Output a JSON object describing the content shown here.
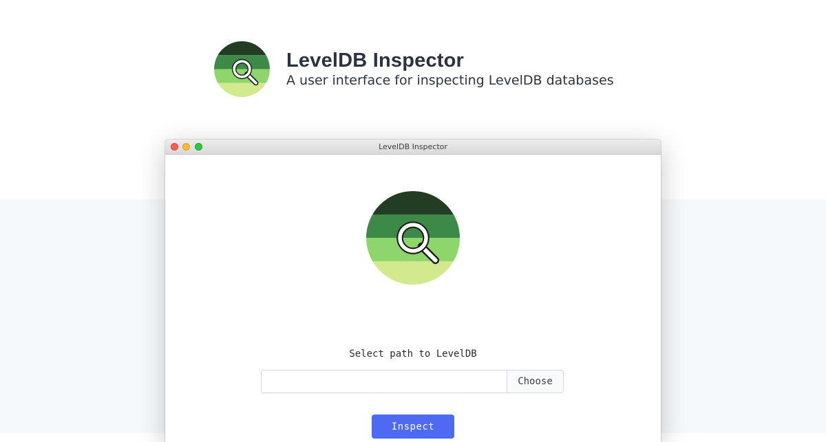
{
  "hero": {
    "title": "LevelDB Inspector",
    "subtitle": "A user interface for inspecting LevelDB databases",
    "logo_icon": "magnifier-stripes-logo-icon"
  },
  "window": {
    "title": "LevelDB Inspector",
    "traffic_lights": [
      "close",
      "minimize",
      "maximize"
    ]
  },
  "form": {
    "label": "Select path to LevelDB",
    "path_value": "",
    "path_placeholder": "",
    "choose_label": "Choose",
    "inspect_label": "Inspect"
  },
  "colors": {
    "logo_stripes": [
      "#233d25",
      "#3d8a48",
      "#8ed56c",
      "#d3e98d"
    ],
    "accent": "#4f6af2",
    "text_dark": "#2b3242",
    "band_background": "#f6f9fb"
  }
}
